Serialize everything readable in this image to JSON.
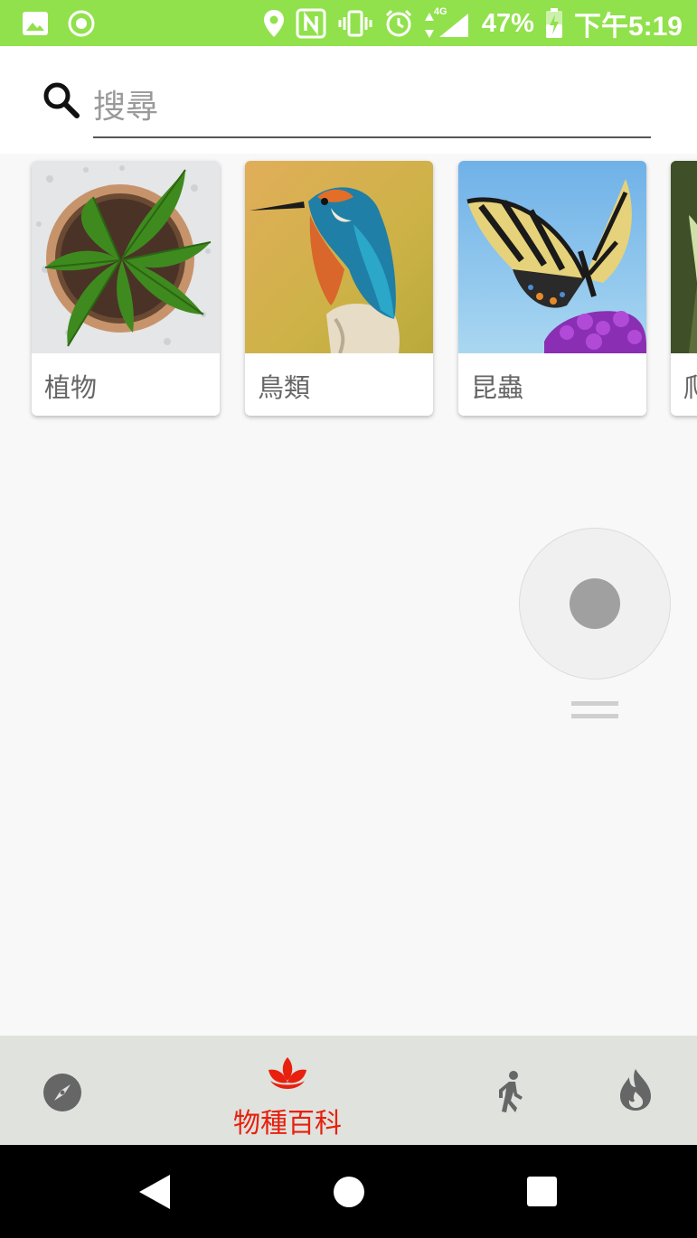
{
  "status_bar": {
    "battery": "47%",
    "time": "下午5:19",
    "network": "4G",
    "background_color": "#90e14b",
    "icons": [
      "image-icon",
      "record-icon",
      "location-icon",
      "nfc-icon",
      "vibrate-icon",
      "alarm-icon",
      "data-arrows-icon",
      "signal-icon",
      "battery-charging-icon"
    ]
  },
  "search": {
    "placeholder": "搜尋",
    "value": ""
  },
  "categories": [
    {
      "label": "植物",
      "icon": "plant-image"
    },
    {
      "label": "鳥類",
      "icon": "kingfisher-image"
    },
    {
      "label": "昆蟲",
      "icon": "butterfly-image"
    },
    {
      "label": "爬",
      "icon": "reptile-image"
    }
  ],
  "bottom_nav": {
    "items": [
      {
        "name": "explore",
        "icon": "compass-icon",
        "active": false
      },
      {
        "name": "encyclopedia",
        "label": "物種百科",
        "icon": "lotus-icon",
        "active": true
      },
      {
        "name": "walk",
        "icon": "walking-icon",
        "active": false
      },
      {
        "name": "hot",
        "icon": "fire-icon",
        "active": false
      }
    ],
    "active_color": "#e8200e"
  },
  "system_nav": {
    "icons": [
      "back-icon",
      "home-icon",
      "recents-icon"
    ]
  }
}
